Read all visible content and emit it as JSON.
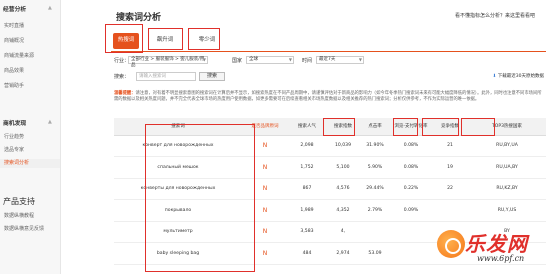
{
  "sidebar": {
    "sections": [
      {
        "title": "经营分析",
        "items": [
          "实时直播",
          "商铺概况",
          "商铺流量来源",
          "商品效果",
          "营销助手"
        ]
      },
      {
        "title": "商机发现",
        "items": [
          "行业趋势",
          "选品专家",
          "搜索词分析"
        ]
      }
    ],
    "product_support": {
      "title": "产品支持",
      "items": [
        "数据纵横教程",
        "数据纵横意见反馈"
      ]
    }
  },
  "header": {
    "title": "搜索词分析",
    "help": "看不懂指标怎么分析？来这里看看吧"
  },
  "tabs": [
    {
      "label": "热搜词",
      "active": true
    },
    {
      "label": "飙升词",
      "active": false
    },
    {
      "label": "零少词",
      "active": false
    }
  ],
  "filters": {
    "industry_label": "行业：",
    "industry_value": "全部行业 > 服装服饰 > 婴儿服装/用品",
    "country_label": "国家",
    "country_value": "全球",
    "time_label": "时间",
    "time_value": "最近7天"
  },
  "search": {
    "label": "搜索：",
    "placeholder": "请输入搜索词",
    "button": "搜索",
    "download": "下载最近30天原始数据"
  },
  "notice": {
    "label": "温馨提醒：",
    "text": "请注意，对有着不明显搜索意图的搜索词在计算后并不显示，如搜索热度在不同产品周期中，请谨慎评估对于新商品的影响力（如今年冬季热门搜索词未来有可能大幅度降低的情况）。此外，同时也注意不同市场间所需的数据以及相关热度问题，并不完全代表全球市场的热度用户使用数据，如更多需要可在后续查看相关市场热度数据以及相关推荐的热门搜索词；分析仅供参考，不作为实际运营的唯一依据。"
  },
  "table": {
    "headers": [
      "搜索词",
      "是否品牌原词",
      "搜索人气",
      "搜索指数",
      "点击率",
      "浏览-支付转化率",
      "竞争指数",
      "TOP3热搜国家"
    ],
    "rows": [
      {
        "keyword": "конверт для новорожденных",
        "brand": "N",
        "popularity": "2,098",
        "index": "10,039",
        "ctr": "31.90%",
        "conv": "0.08%",
        "competition": "21",
        "top3": "RU,BY,UA"
      },
      {
        "keyword": "спальный мешок",
        "brand": "N",
        "popularity": "1,752",
        "index": "5,100",
        "ctr": "5.90%",
        "conv": "0.08%",
        "competition": "19",
        "top3": "RU,UA,BY"
      },
      {
        "keyword": "конверты для новорожденных",
        "brand": "N",
        "popularity": "867",
        "index": "4,576",
        "ctr": "29.44%",
        "conv": "0.22%",
        "competition": "22",
        "top3": "RU,KZ,BY"
      },
      {
        "keyword": "покрывало",
        "brand": "N",
        "popularity": "1,989",
        "index": "4,352",
        "ctr": "2.79%",
        "conv": "0.09%",
        "competition": "",
        "top3": "RU,Y,US"
      },
      {
        "keyword": "мультиметр",
        "brand": "N",
        "popularity": "3,583",
        "index": "4,",
        "ctr": "",
        "conv": "",
        "competition": "",
        "top3": "BY"
      },
      {
        "keyword": "baby sleeping bag",
        "brand": "N",
        "popularity": "484",
        "index": "2,974",
        "ctr": "53.09",
        "conv": "",
        "competition": "",
        "top3": ""
      }
    ]
  },
  "watermark": {
    "text": "乐发网",
    "url": "www.6pf.cn"
  }
}
